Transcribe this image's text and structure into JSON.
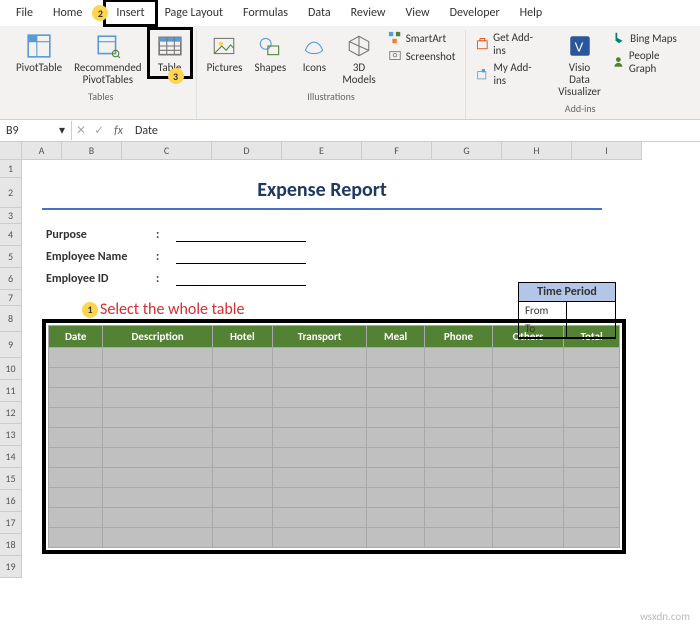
{
  "ribbonTabs": [
    "File",
    "Home",
    "Insert",
    "Page Layout",
    "Formulas",
    "Data",
    "Review",
    "View",
    "Developer",
    "Help"
  ],
  "highlightTab": "Insert",
  "groups": {
    "tables": {
      "label": "Tables",
      "pivot": "PivotTable",
      "rec": "Recommended\nPivotTables",
      "table": "Table"
    },
    "illus": {
      "label": "Illustrations",
      "pictures": "Pictures",
      "shapes": "Shapes",
      "icons": "Icons",
      "models": "3D\nModels",
      "smartart": "SmartArt",
      "screenshot": "Screenshot"
    },
    "addins": {
      "label": "Add-ins",
      "get": "Get Add-ins",
      "my": "My Add-ins",
      "visio": "Visio Data\nVisualizer",
      "bing": "Bing Maps",
      "people": "People Graph"
    }
  },
  "nameBox": "B9",
  "formula": "Date",
  "cols": [
    "A",
    "B",
    "C",
    "D",
    "E",
    "F",
    "G",
    "H",
    "I"
  ],
  "rows": [
    "1",
    "2",
    "3",
    "4",
    "5",
    "6",
    "7",
    "8",
    "9",
    "10",
    "11",
    "12",
    "13",
    "14",
    "15",
    "16",
    "17",
    "18",
    "19"
  ],
  "report": {
    "title": "Expense Report",
    "purpose": "Purpose",
    "empname": "Employee Name",
    "empid": "Employee ID",
    "colon": ":",
    "timePeriod": "Time Period",
    "from": "From",
    "to": "To"
  },
  "annotationText": "Select the whole table",
  "tableHeaders": [
    "Date",
    "Description",
    "Hotel",
    "Transport",
    "Meal",
    "Phone",
    "Others",
    "Total"
  ],
  "callouts": {
    "one": "1",
    "two": "2",
    "three": "3"
  },
  "watermark": "wsxdn.com"
}
